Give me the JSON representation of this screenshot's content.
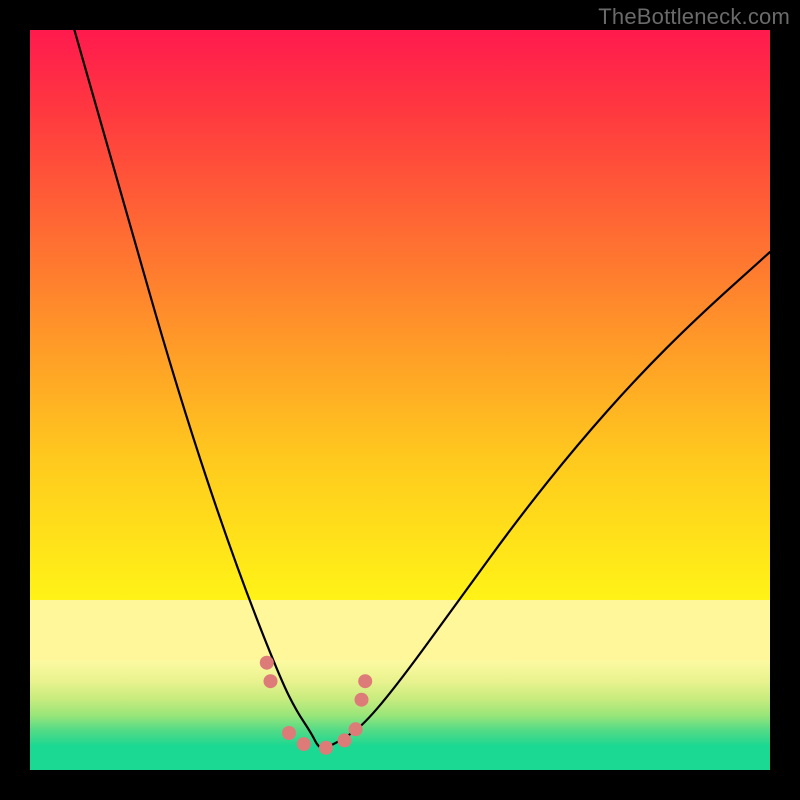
{
  "attribution": "TheBottleneck.com",
  "chart_data": {
    "type": "line",
    "title": "",
    "xlabel": "",
    "ylabel": "",
    "ylim": [
      0,
      100
    ],
    "xlim": [
      0,
      100
    ],
    "series": [
      {
        "name": "bottleneck-curve",
        "x": [
          6,
          10,
          14,
          18,
          22,
          26,
          30,
          34,
          36,
          38,
          39,
          40,
          42,
          45,
          50,
          58,
          66,
          74,
          82,
          90,
          100
        ],
        "values": [
          100,
          86,
          72,
          58,
          45,
          33,
          22,
          12,
          8,
          5,
          3,
          3,
          4,
          6,
          12,
          23,
          34,
          44,
          53,
          61,
          70
        ]
      }
    ],
    "markers": {
      "name": "highlight-points",
      "x": [
        32.0,
        32.5,
        35.0,
        37.0,
        40.0,
        42.5,
        44.0,
        44.8,
        45.3
      ],
      "values": [
        14.5,
        12.0,
        5.0,
        3.5,
        3.0,
        4.0,
        5.5,
        9.5,
        12.0
      ],
      "color": "#dd7b78",
      "size": 14
    },
    "background_gradient": {
      "type": "severity-heatmap",
      "stops": [
        {
          "pos": 0.0,
          "color": "#ff1a4e"
        },
        {
          "pos": 0.77,
          "color": "#fff317"
        },
        {
          "pos": 0.82,
          "color": "#fff79a"
        },
        {
          "pos": 0.97,
          "color": "#1bd892"
        }
      ]
    }
  }
}
